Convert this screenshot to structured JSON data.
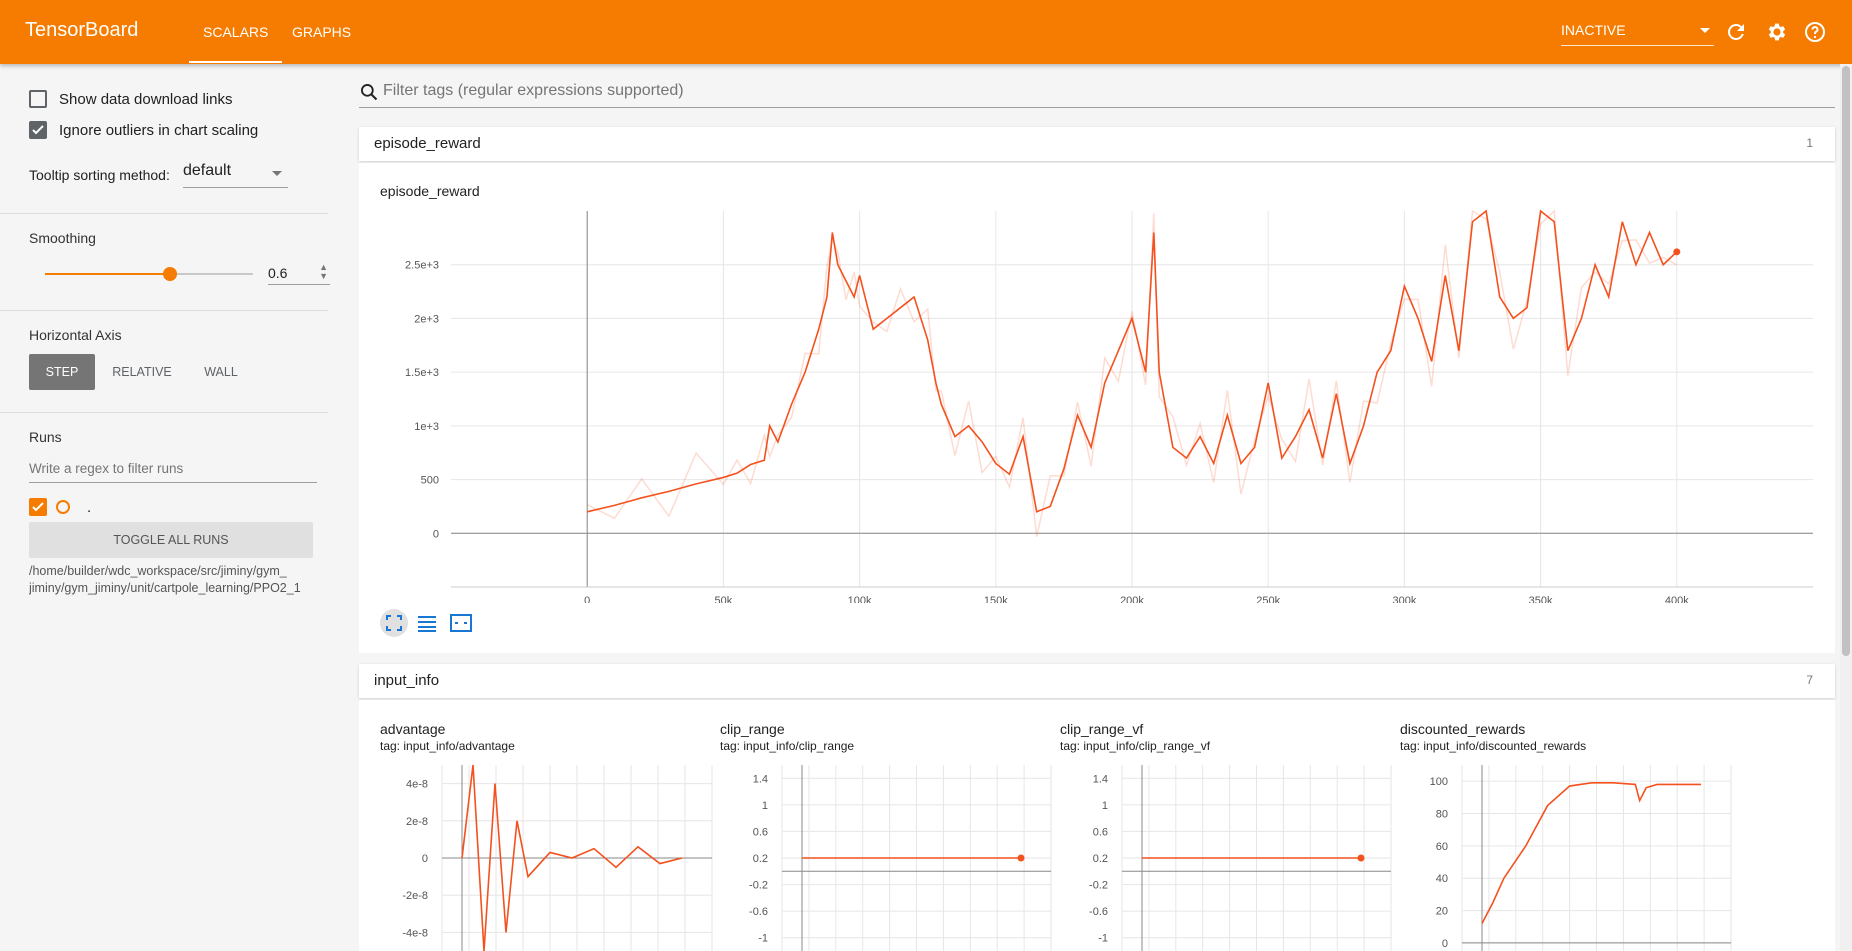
{
  "app": {
    "title": "TensorBoard",
    "accent": "#f57c00"
  },
  "tabs": [
    {
      "label": "SCALARS",
      "active": true
    },
    {
      "label": "GRAPHS",
      "active": false
    }
  ],
  "header": {
    "status": "INACTIVE",
    "icons": [
      "refresh-icon",
      "settings-icon",
      "help-icon"
    ]
  },
  "sidebar": {
    "show_download_links": {
      "label": "Show data download links",
      "checked": false
    },
    "ignore_outliers": {
      "label": "Ignore outliers in chart scaling",
      "checked": true
    },
    "tooltip_sorting": {
      "label": "Tooltip sorting method:",
      "value": "default"
    },
    "smoothing": {
      "label": "Smoothing",
      "value": "0.6",
      "fraction": 0.6
    },
    "horizontal_axis": {
      "label": "Horizontal Axis",
      "options": [
        "STEP",
        "RELATIVE",
        "WALL"
      ],
      "selected": "STEP"
    },
    "runs": {
      "label": "Runs",
      "filter_placeholder": "Write a regex to filter runs",
      "run_name": ".",
      "toggle_label": "TOGGLE ALL RUNS",
      "path_line1": "/home/builder/wdc_workspace/src/jiminy/gym_",
      "path_line2": "jiminy/gym_jiminy/unit/cartpole_learning/PPO2_1"
    }
  },
  "main": {
    "filter_placeholder": "Filter tags (regular expressions supported)",
    "categories": [
      {
        "name": "episode_reward",
        "count": "1"
      },
      {
        "name": "input_info",
        "count": "7"
      }
    ]
  },
  "chart_data": [
    {
      "type": "line",
      "title": "episode_reward",
      "x_ticks": [
        "0",
        "50k",
        "100k",
        "150k",
        "200k",
        "250k",
        "300k",
        "350k",
        "400k"
      ],
      "y_ticks": [
        "0",
        "500",
        "1e+3",
        "1.5e+3",
        "2e+3",
        "2.5e+3"
      ],
      "xlim": [
        -50000,
        450000
      ],
      "ylim": [
        -500,
        3000
      ],
      "series": [
        {
          "x": [
            0,
            10000,
            20000,
            30000,
            40000,
            50000,
            55000,
            60000,
            65000,
            67000,
            70000,
            75000,
            80000,
            85000,
            88000,
            90000,
            92000,
            95000,
            98000,
            100000,
            105000,
            110000,
            115000,
            120000,
            125000,
            128000,
            130000,
            135000,
            140000,
            145000,
            150000,
            155000,
            160000,
            165000,
            170000,
            175000,
            180000,
            185000,
            190000,
            195000,
            200000,
            205000,
            208000,
            210000,
            215000,
            220000,
            225000,
            230000,
            235000,
            240000,
            245000,
            250000,
            255000,
            260000,
            265000,
            270000,
            275000,
            280000,
            285000,
            290000,
            295000,
            300000,
            305000,
            310000,
            315000,
            320000,
            325000,
            330000,
            335000,
            340000,
            345000,
            350000,
            355000,
            360000,
            365000,
            370000,
            375000,
            380000,
            385000,
            390000,
            395000,
            400000
          ],
          "y": [
            200,
            260,
            330,
            390,
            460,
            520,
            560,
            640,
            680,
            1000,
            850,
            1200,
            1500,
            1900,
            2200,
            2800,
            2500,
            2350,
            2200,
            2400,
            1900,
            2000,
            2100,
            2200,
            1800,
            1400,
            1200,
            900,
            1000,
            850,
            650,
            550,
            900,
            200,
            250,
            600,
            1100,
            800,
            1400,
            1700,
            2000,
            1500,
            2800,
            1500,
            800,
            700,
            900,
            650,
            1100,
            650,
            800,
            1400,
            700,
            900,
            1150,
            700,
            1300,
            650,
            1000,
            1500,
            1700,
            2300,
            2000,
            1600,
            2400,
            1700,
            2900,
            3100,
            2200,
            2000,
            2100,
            3000,
            2900,
            1700,
            2000,
            2500,
            2200,
            2900,
            2500,
            2800,
            2500,
            2620
          ]
        }
      ]
    },
    {
      "type": "line",
      "title": "advantage",
      "tag": "tag: input_info/advantage",
      "y_ticks": [
        "4e-8",
        "2e-8",
        "0",
        "-2e-8",
        "-4e-8"
      ],
      "series": [
        {
          "x": [
            0,
            0.05,
            0.1,
            0.15,
            0.2,
            0.25,
            0.3,
            0.4,
            0.5,
            0.6,
            0.7,
            0.8,
            0.9,
            1.0
          ],
          "y": [
            0,
            5e-08,
            -5e-08,
            4e-08,
            -4e-08,
            2e-08,
            -1e-08,
            3e-09,
            0,
            5e-09,
            -5e-09,
            6e-09,
            -3e-09,
            0
          ]
        }
      ]
    },
    {
      "type": "line",
      "title": "clip_range",
      "tag": "tag: input_info/clip_range",
      "y_ticks": [
        "1.4",
        "1",
        "0.6",
        "0.2",
        "-0.2",
        "-0.6",
        "-1"
      ],
      "series": [
        {
          "x": [
            0,
            1
          ],
          "y": [
            0.2,
            0.2
          ]
        }
      ]
    },
    {
      "type": "line",
      "title": "clip_range_vf",
      "tag": "tag: input_info/clip_range_vf",
      "y_ticks": [
        "1.4",
        "1",
        "0.6",
        "0.2",
        "-0.2",
        "-0.6",
        "-1"
      ],
      "series": [
        {
          "x": [
            0,
            1
          ],
          "y": [
            0.2,
            0.2
          ]
        }
      ]
    },
    {
      "type": "line",
      "title": "discounted_rewards",
      "tag": "tag: input_info/discounted_rewards",
      "y_ticks": [
        "100",
        "80",
        "60",
        "40",
        "20",
        "0"
      ],
      "series": [
        {
          "x": [
            0,
            0.05,
            0.1,
            0.2,
            0.3,
            0.4,
            0.5,
            0.6,
            0.7,
            0.72,
            0.75,
            0.8,
            0.9,
            1.0
          ],
          "y": [
            12,
            25,
            40,
            60,
            85,
            97,
            99,
            99,
            98,
            88,
            96,
            98,
            98,
            98
          ]
        }
      ]
    }
  ]
}
